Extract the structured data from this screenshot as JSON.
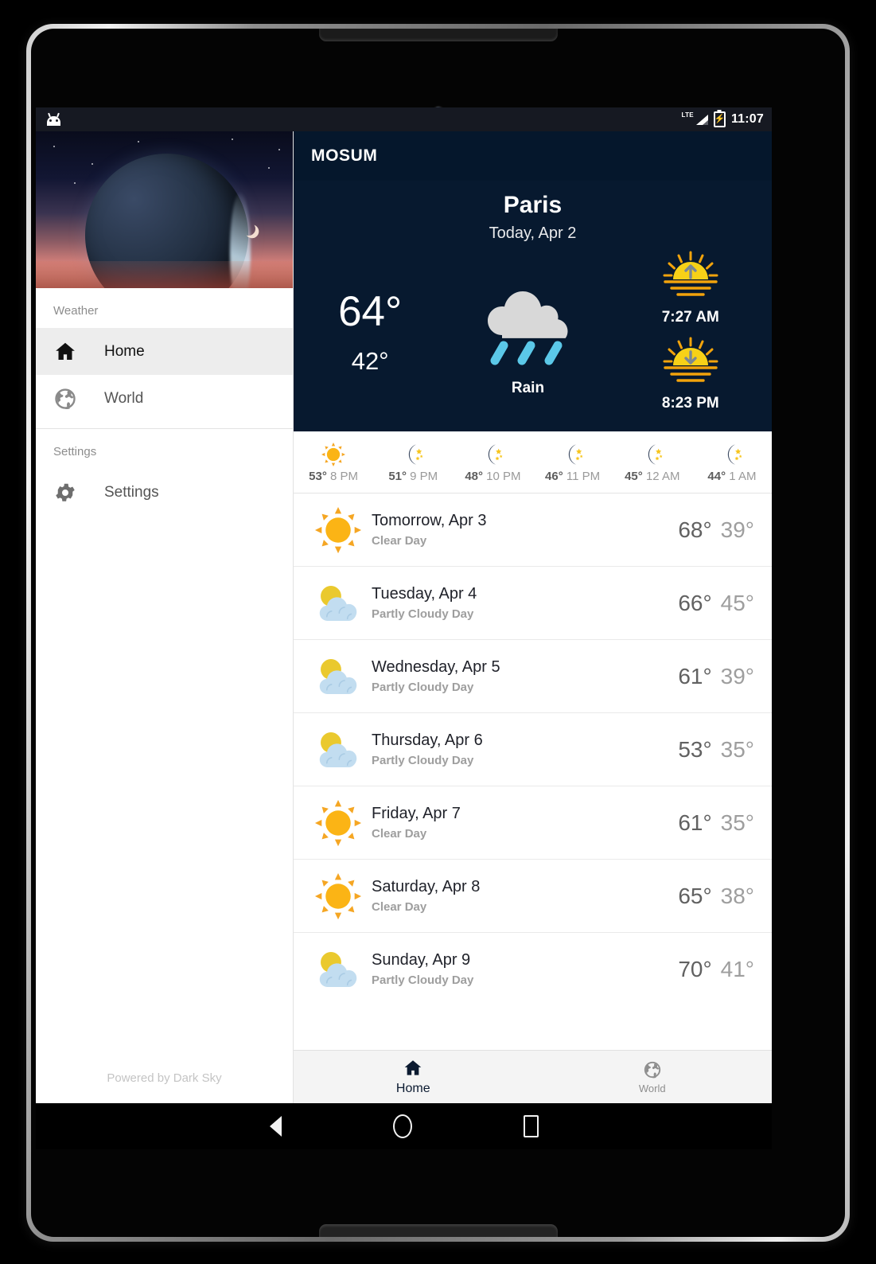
{
  "status_bar": {
    "app_icon": "android-head-icon",
    "network": "LTE",
    "battery_icon": "battery-charging-icon",
    "time": "11:07"
  },
  "drawer": {
    "header_image": "planet-sunset-banner",
    "sections": [
      {
        "label": "Weather",
        "items": [
          {
            "icon": "home-icon",
            "label": "Home",
            "active": true
          },
          {
            "icon": "globe-icon",
            "label": "World",
            "active": false
          }
        ]
      },
      {
        "label": "Settings",
        "items": [
          {
            "icon": "gear-icon",
            "label": "Settings",
            "active": false
          }
        ]
      }
    ],
    "footer": "Powered by Dark Sky"
  },
  "appbar": {
    "title": "MOSUM"
  },
  "current": {
    "city": "Paris",
    "date": "Today, Apr 2",
    "high": "64°",
    "low": "42°",
    "condition": "Rain",
    "condition_icon": "rain-icon",
    "sunrise_icon": "sunrise-icon",
    "sunrise": "7:27 AM",
    "sunset_icon": "sunset-icon",
    "sunset": "8:23 PM"
  },
  "hourly": [
    {
      "icon": "sun-icon",
      "temp": "53°",
      "time": "8 PM"
    },
    {
      "icon": "moon-icon",
      "temp": "51°",
      "time": "9 PM"
    },
    {
      "icon": "moon-icon",
      "temp": "48°",
      "time": "10 PM"
    },
    {
      "icon": "moon-icon",
      "temp": "46°",
      "time": "11 PM"
    },
    {
      "icon": "moon-icon",
      "temp": "45°",
      "time": "12 AM"
    },
    {
      "icon": "moon-icon",
      "temp": "44°",
      "time": "1 AM"
    }
  ],
  "daily": [
    {
      "icon": "sun-icon",
      "name": "Tomorrow, Apr 3",
      "condition": "Clear Day",
      "high": "68°",
      "low": "39°"
    },
    {
      "icon": "partly-cloudy-icon",
      "name": "Tuesday, Apr 4",
      "condition": "Partly Cloudy Day",
      "high": "66°",
      "low": "45°"
    },
    {
      "icon": "partly-cloudy-icon",
      "name": "Wednesday, Apr 5",
      "condition": "Partly Cloudy Day",
      "high": "61°",
      "low": "39°"
    },
    {
      "icon": "partly-cloudy-icon",
      "name": "Thursday, Apr 6",
      "condition": "Partly Cloudy Day",
      "high": "53°",
      "low": "35°"
    },
    {
      "icon": "sun-icon",
      "name": "Friday, Apr 7",
      "condition": "Clear Day",
      "high": "61°",
      "low": "35°"
    },
    {
      "icon": "sun-icon",
      "name": "Saturday, Apr 8",
      "condition": "Clear Day",
      "high": "65°",
      "low": "38°"
    },
    {
      "icon": "partly-cloudy-icon",
      "name": "Sunday, Apr 9",
      "condition": "Partly Cloudy Day",
      "high": "70°",
      "low": "41°"
    }
  ],
  "bottom_nav": [
    {
      "icon": "home-icon",
      "label": "Home",
      "active": true
    },
    {
      "icon": "globe-icon",
      "label": "World",
      "active": false
    }
  ],
  "system_nav": {
    "back": "back-icon",
    "home": "home-circle-icon",
    "recents": "recents-icon"
  },
  "colors": {
    "header_navy": "#05172c",
    "accent_yellow": "#f7b500",
    "rain_blue": "#5bc8e8",
    "cloud_gray": "#d8d8d8",
    "partly_cloud_blue": "#c2ddf0"
  }
}
